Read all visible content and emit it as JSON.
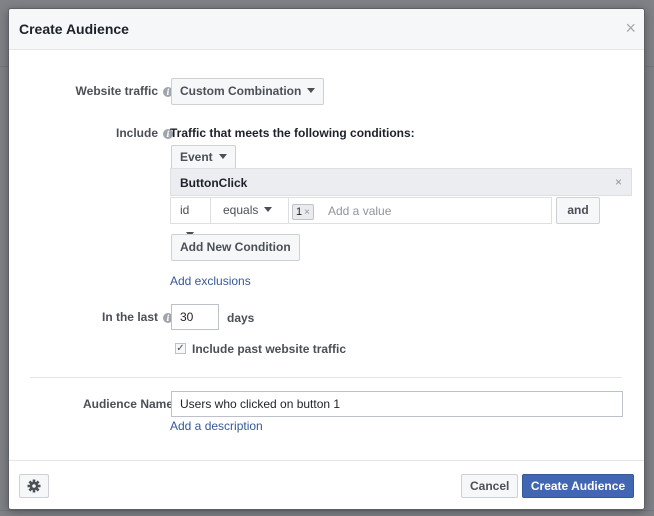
{
  "dialog": {
    "title": "Create Audience",
    "close_icon": "close-icon"
  },
  "website_traffic": {
    "label": "Website traffic",
    "selected": "Custom Combination"
  },
  "include": {
    "label": "Include",
    "description": "Traffic that meets the following conditions:",
    "type_selected": "Event",
    "event": {
      "name": "ButtonClick",
      "remove_glyph": "×",
      "condition": {
        "param": "id",
        "operator": "equals",
        "values": [
          "1"
        ],
        "token_remove_glyph": "×",
        "value_placeholder": "Add a value",
        "and_label": "and"
      }
    },
    "add_condition_label": "Add New Condition",
    "add_exclusions_label": "Add exclusions"
  },
  "in_the_last": {
    "label": "In the last",
    "value": "30",
    "unit": "days",
    "include_past_label": "Include past website traffic",
    "include_past_checked": true
  },
  "audience_name": {
    "label": "Audience Name",
    "value": "Users who clicked on button 1",
    "add_description_label": "Add a description"
  },
  "footer": {
    "settings_icon": "gear-icon",
    "cancel_label": "Cancel",
    "create_label": "Create Audience"
  },
  "colors": {
    "primary": "#4267b2",
    "link": "#365899"
  }
}
